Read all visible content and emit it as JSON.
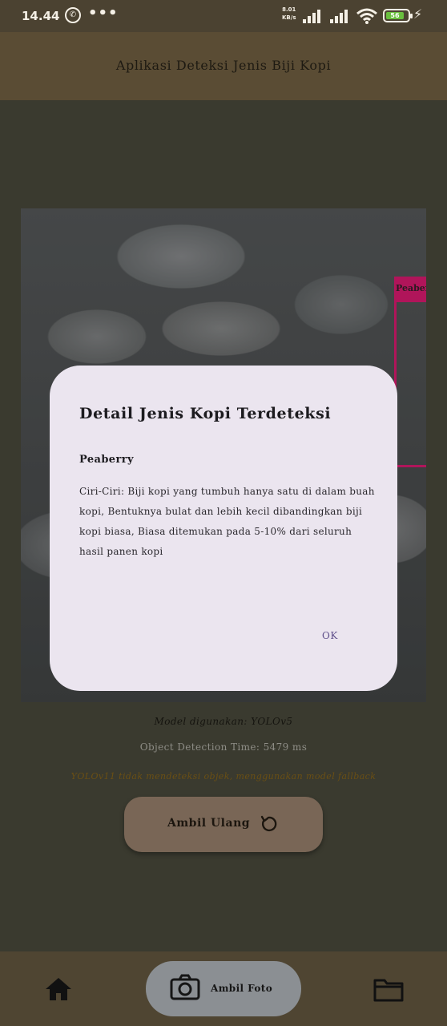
{
  "status_bar": {
    "time": "14.44",
    "more": "•••",
    "net_speed_value": "8.01",
    "net_speed_unit": "KB/s",
    "battery_level": "56"
  },
  "app": {
    "title": "Aplikasi Deteksi Jenis Biji Kopi"
  },
  "detection": {
    "box_label": "Peaberry"
  },
  "results": {
    "model_used": "Model digunakan: YOLOv5",
    "detection_time": "Object Detection Time: 5479 ms",
    "fallback_notice": "YOLOv11 tidak mendeteksi objek, menggunakan model fallback"
  },
  "retake_button": {
    "label": "Ambil Ulang"
  },
  "bottom_nav": {
    "camera_label": "Ambil Foto"
  },
  "dialog": {
    "title": "Detail Jenis Kopi Terdeteksi",
    "name": "Peaberry",
    "description": "Ciri-Ciri: Biji kopi yang tumbuh hanya satu di dalam buah kopi, Bentuknya bulat dan lebih kecil dibandingkan biji kopi biasa, Biasa ditemukan pada 5-10% dari seluruh hasil panen kopi",
    "ok_label": "OK"
  },
  "colors": {
    "app_bar": "#5a4c34",
    "dim_background": "#3a3a2f",
    "dialog_surface": "#ebe5ef",
    "detection_box": "#b0155a",
    "accent_text": "#5e4f8a"
  }
}
